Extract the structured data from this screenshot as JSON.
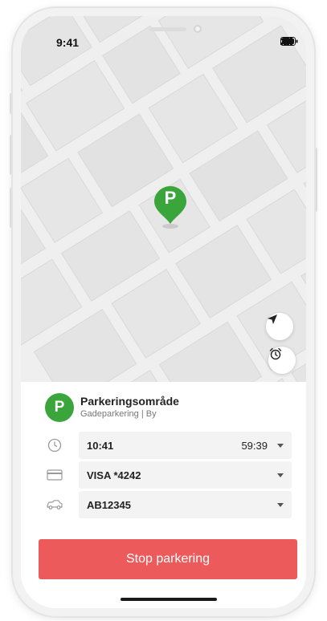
{
  "status_bar": {
    "time": "9:41"
  },
  "zone": {
    "badge": "P",
    "title": "Parkeringsområde",
    "subtitle": "Gadeparkering | By"
  },
  "pin": {
    "label": "P"
  },
  "fields": [
    {
      "icon": "clock-icon",
      "value": "10:41",
      "right": "59:39"
    },
    {
      "icon": "credit-card-icon",
      "value": "VISA *4242"
    },
    {
      "icon": "car-icon",
      "value": "AB12345"
    }
  ],
  "stop_button": {
    "label": "Stop parkering"
  },
  "colors": {
    "accent_green": "#3aa53a",
    "stop_red": "#ec5a5b"
  }
}
